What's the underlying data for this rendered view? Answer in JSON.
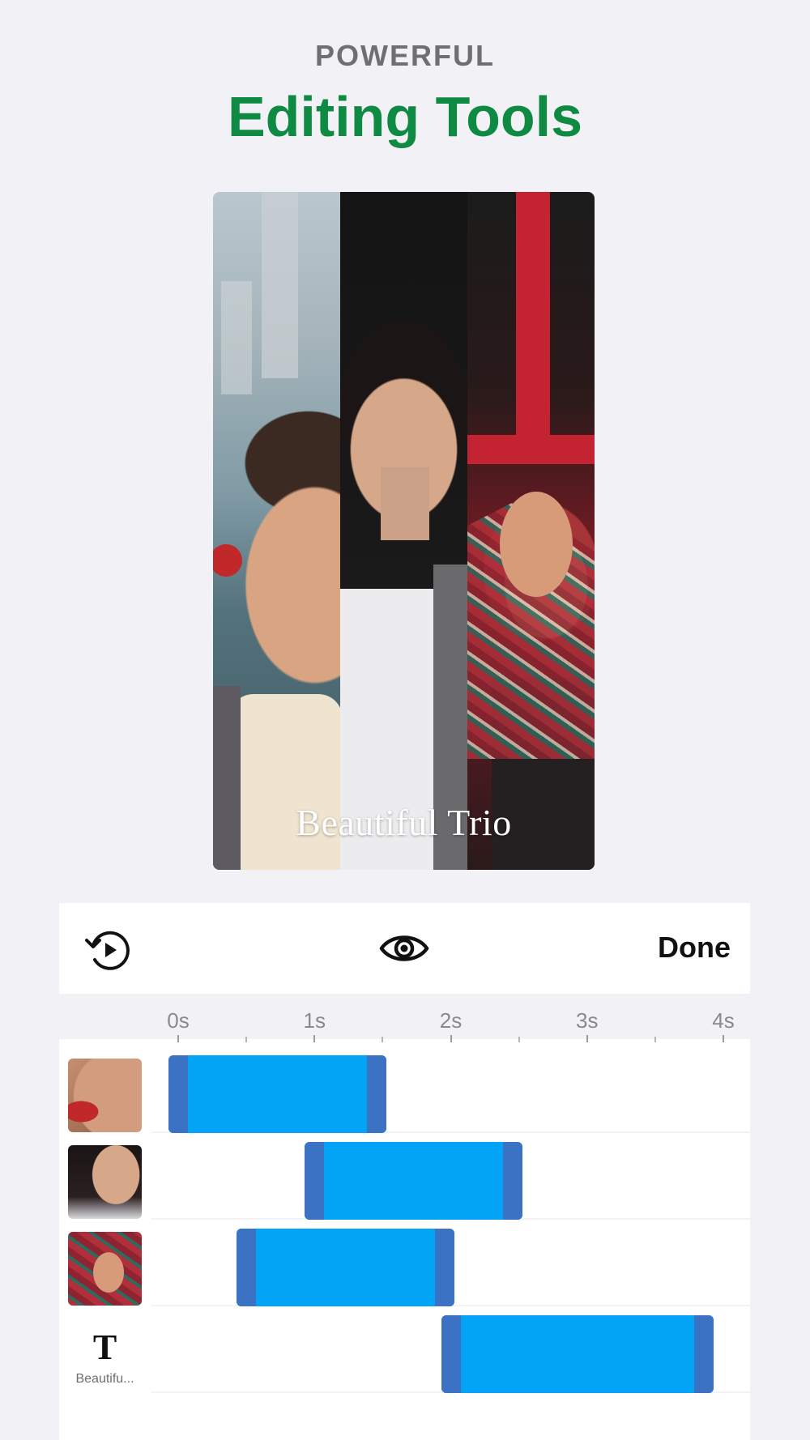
{
  "header": {
    "eyebrow": "POWERFUL",
    "headline": "Editing Tools",
    "headline_color": "#0f8a43"
  },
  "preview": {
    "caption": "Beautiful Trio"
  },
  "toolbar": {
    "replay_icon": "replay-play-icon",
    "preview_icon": "eye-icon",
    "done_label": "Done"
  },
  "timeline": {
    "ticks": [
      "0s",
      "1s",
      "2s",
      "3s",
      "4s"
    ],
    "duration_seconds": 4,
    "clip_color": "#03a4f5",
    "handle_color": "#3b72c4",
    "tracks": [
      {
        "type": "photo",
        "start": 0.0,
        "end": 1.6
      },
      {
        "type": "photo",
        "start": 1.0,
        "end": 2.6
      },
      {
        "type": "photo",
        "start": 0.5,
        "end": 2.1
      },
      {
        "type": "text",
        "label": "Beautifu...",
        "icon_glyph": "T",
        "start": 2.0,
        "end": 4.0
      }
    ]
  }
}
